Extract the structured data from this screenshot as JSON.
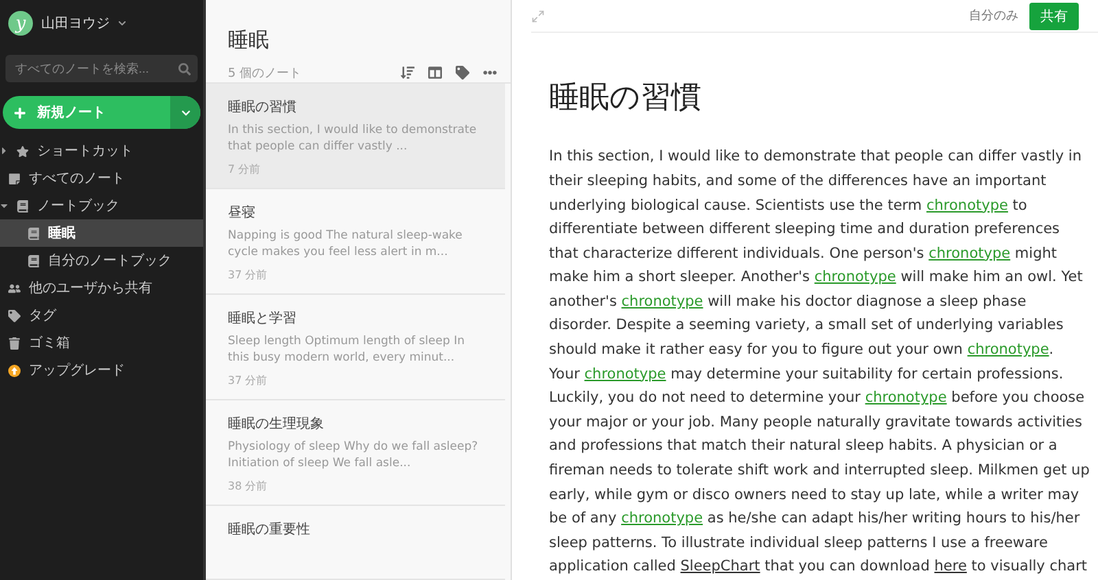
{
  "account": {
    "initial": "y",
    "name": "山田ヨウジ"
  },
  "search": {
    "placeholder": "すべてのノートを検索..."
  },
  "new_note": {
    "label": "新規ノート"
  },
  "sidebar": {
    "items": [
      {
        "label": "ショートカット",
        "expanded": false,
        "selected": false
      },
      {
        "label": "すべてのノート",
        "selected": false
      },
      {
        "label": "ノートブック",
        "expanded": true,
        "selected": false,
        "children": [
          {
            "label": "睡眠",
            "selected": true
          },
          {
            "label": "自分のノートブック",
            "selected": false
          }
        ]
      },
      {
        "label": "他のユーザから共有",
        "selected": false
      },
      {
        "label": "タグ",
        "selected": false
      },
      {
        "label": "ゴミ箱",
        "selected": false
      },
      {
        "label": "アップグレード",
        "selected": false
      }
    ]
  },
  "note_list": {
    "title": "睡眠",
    "count": "5 個のノート",
    "notes": [
      {
        "title": "睡眠の習慣",
        "snippet": "In this section, I would like to demonstrate that people can differ vastly ...",
        "time": "7 分前",
        "selected": true
      },
      {
        "title": "昼寝",
        "snippet": "Napping is good The natural sleep-wake cycle makes you feel less alert in m...",
        "time": "37 分前",
        "selected": false
      },
      {
        "title": "睡眠と学習",
        "snippet": "Sleep length Optimum length of sleep In this busy modern world, every minut...",
        "time": "37 分前",
        "selected": false
      },
      {
        "title": "睡眠の生理現象",
        "snippet": "Physiology of sleep Why do we fall asleep? Initiation of sleep We fall asle...",
        "time": "38 分前",
        "selected": false
      },
      {
        "title": "睡眠の重要性",
        "selected": false
      }
    ]
  },
  "editor": {
    "visibility": "自分のみ",
    "share": "共有",
    "title": "睡眠の習慣",
    "paragraphs": [
      [
        {
          "kind": "plain",
          "text": "In this section, I would like to demonstrate that people can differ vastly in their sleeping habits, and some of the differences have an important underlying biological cause. Scientists use the term "
        },
        {
          "kind": "link",
          "text": "chronotype"
        },
        {
          "kind": "plain",
          "text": " to differentiate between different sleeping time and duration preferences that characterize different individuals. One person's "
        },
        {
          "kind": "link",
          "text": "chronotype"
        },
        {
          "kind": "plain",
          "text": " might make him a short sleeper. Another's "
        },
        {
          "kind": "link",
          "text": "chronotype"
        },
        {
          "kind": "plain",
          "text": " will make him an owl. Yet another's "
        },
        {
          "kind": "link",
          "text": "chronotype"
        },
        {
          "kind": "plain",
          "text": " will make his doctor diagnose a sleep phase disorder. Despite a seeming variety, a small set of underlying variables should make it rather easy for you to figure out your own "
        },
        {
          "kind": "link",
          "text": "chronotype"
        },
        {
          "kind": "plain",
          "text": "."
        }
      ],
      [
        {
          "kind": "plain",
          "text": "Your "
        },
        {
          "kind": "link",
          "text": "chronotype"
        },
        {
          "kind": "plain",
          "text": " may determine your suitability for certain professions. Luckily, you do not need to determine your "
        },
        {
          "kind": "link",
          "text": "chronotype"
        },
        {
          "kind": "plain",
          "text": " before you choose your major or your job. Many people naturally gravitate towards activities and professions that match their natural sleep habits. A physician or a fireman needs to tolerate shift work and interrupted sleep. Milkmen get up early, while gym or disco owners need to stay up late, while a writer may be of any "
        },
        {
          "kind": "link",
          "text": "chronotype"
        },
        {
          "kind": "plain",
          "text": " as he/she can adapt his/her writing hours to his/her sleep patterns. To illustrate individual sleep patterns I use a freeware application called "
        },
        {
          "kind": "underline",
          "text": "SleepChart"
        },
        {
          "kind": "plain",
          "text": " that you can download "
        },
        {
          "kind": "underline",
          "text": "here"
        },
        {
          "kind": "plain",
          "text": " to visually chart"
        }
      ]
    ]
  }
}
